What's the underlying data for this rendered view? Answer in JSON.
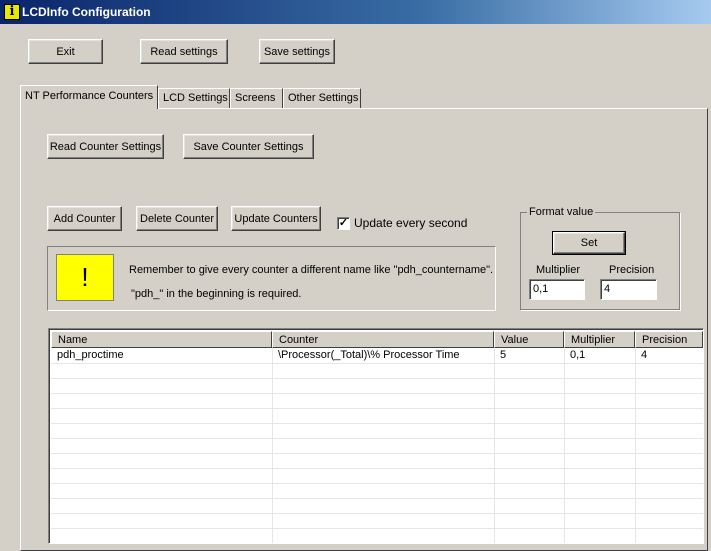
{
  "window": {
    "title": "LCDInfo Configuration",
    "icon": "info-i-icon"
  },
  "toolbar": {
    "exit_label": "Exit",
    "read_label": "Read settings",
    "save_label": "Save settings"
  },
  "tabs": [
    {
      "label": "NT Performance Counters",
      "active": true
    },
    {
      "label": "LCD Settings",
      "active": false
    },
    {
      "label": "Screens",
      "active": false
    },
    {
      "label": "Other Settings",
      "active": false
    }
  ],
  "counter_settings": {
    "read_label": "Read Counter Settings",
    "save_label": "Save Counter Settings"
  },
  "counter_actions": {
    "add_label": "Add Counter",
    "delete_label": "Delete Counter",
    "update_label": "Update Counters",
    "update_every_second_label": "Update every second",
    "update_every_second_checked": true
  },
  "info": {
    "line1": "Remember to give every counter a different name like \"pdh_countername\".",
    "line2": "\"pdh_\" in the beginning is required.",
    "icon": "exclamation-icon",
    "color": "#ffff00"
  },
  "format_value": {
    "label": "Format value",
    "set_label": "Set",
    "multiplier_label": "Multiplier",
    "multiplier_value": "0,1",
    "precision_label": "Precision",
    "precision_value": "4"
  },
  "table": {
    "columns": [
      "Name",
      "Counter",
      "Value",
      "Multiplier",
      "Precision"
    ],
    "rows": [
      [
        "pdh_proctime",
        "\\Processor(_Total)\\% Processor Time",
        "5",
        "0,1",
        "4"
      ]
    ]
  }
}
